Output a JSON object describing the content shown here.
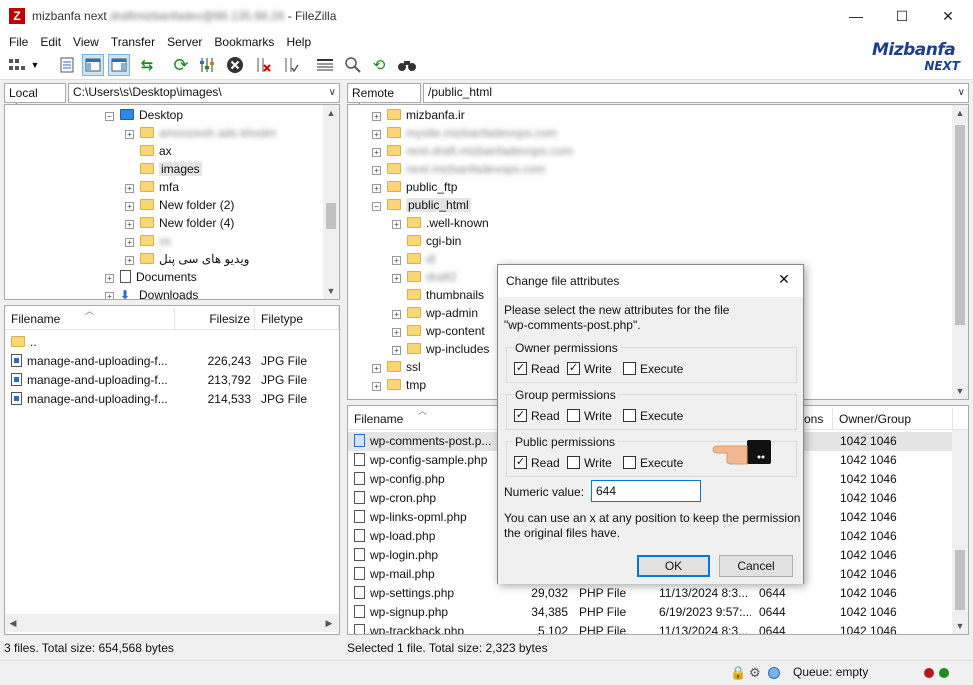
{
  "window": {
    "title_site": "mizbanfa next",
    "title_blurred": "draftmizbanfadev@86.135.68.26",
    "title_app": "- FileZilla",
    "controls": {
      "minimize": "—",
      "maximize": "☐",
      "close": "✕"
    }
  },
  "menu": [
    "File",
    "Edit",
    "View",
    "Transfer",
    "Server",
    "Bookmarks",
    "Help"
  ],
  "brand": {
    "name": "Mizbanfa",
    "sub": "NEXT"
  },
  "local": {
    "label": "Local site:",
    "path": "C:\\Users\\s\\Desktop\\images\\",
    "tree": [
      {
        "label": "Desktop",
        "expander": "-",
        "blurred": false,
        "kind": "desktop"
      },
      {
        "label": "amoozesh ads khodm",
        "expander": "+",
        "blurred": true
      },
      {
        "label": "ax",
        "expander": "",
        "blurred": false
      },
      {
        "label": "images",
        "expander": "",
        "blurred": false,
        "selected": true
      },
      {
        "label": "mfa",
        "expander": "+",
        "blurred": false
      },
      {
        "label": "New folder (2)",
        "expander": "+",
        "blurred": false
      },
      {
        "label": "New folder (4)",
        "expander": "+",
        "blurred": false
      },
      {
        "label": "ss",
        "expander": "+",
        "blurred": true
      },
      {
        "label": "ویدیو های سی پنل",
        "expander": "+",
        "blurred": false
      },
      {
        "label": "Documents",
        "expander": "+",
        "blurred": false,
        "kind": "docs"
      },
      {
        "label": "Downloads",
        "expander": "+",
        "blurred": false,
        "kind": "downloads"
      }
    ],
    "columns": [
      "Filename",
      "Filesize",
      "Filetype"
    ],
    "files": [
      {
        "name": "..",
        "size": "",
        "type": "",
        "kind": "folder"
      },
      {
        "name": "manage-and-uploading-f...",
        "size": "226,243",
        "type": "JPG File",
        "kind": "jpg"
      },
      {
        "name": "manage-and-uploading-f...",
        "size": "213,792",
        "type": "JPG File",
        "kind": "jpg"
      },
      {
        "name": "manage-and-uploading-f...",
        "size": "214,533",
        "type": "JPG File",
        "kind": "jpg"
      }
    ],
    "status": "3 files. Total size: 654,568 bytes"
  },
  "remote": {
    "label": "Remote site:",
    "path": "/public_html",
    "tree": [
      {
        "label": "mizbanfa.ir",
        "indent": 0,
        "expander": "+",
        "blurred": false
      },
      {
        "label": "mysite.mizbanfadevops.com",
        "indent": 0,
        "expander": "+",
        "blurred": true
      },
      {
        "label": "next.draft.mizbanfadevops.com",
        "indent": 0,
        "expander": "+",
        "blurred": true
      },
      {
        "label": "next.mizbanfadevops.com",
        "indent": 0,
        "expander": "+",
        "blurred": true
      },
      {
        "label": "public_ftp",
        "indent": 0,
        "expander": "+",
        "blurred": false
      },
      {
        "label": "public_html",
        "indent": 0,
        "expander": "-",
        "blurred": false,
        "selected": true
      },
      {
        "label": ".well-known",
        "indent": 1,
        "expander": "+",
        "blurred": false
      },
      {
        "label": "cgi-bin",
        "indent": 1,
        "expander": "",
        "blurred": false
      },
      {
        "label": "dl",
        "indent": 1,
        "expander": "+",
        "blurred": true
      },
      {
        "label": "draft2",
        "indent": 1,
        "expander": "+",
        "blurred": true
      },
      {
        "label": "thumbnails",
        "indent": 1,
        "expander": "",
        "blurred": false
      },
      {
        "label": "wp-admin",
        "indent": 1,
        "expander": "+",
        "blurred": false
      },
      {
        "label": "wp-content",
        "indent": 1,
        "expander": "+",
        "blurred": false
      },
      {
        "label": "wp-includes",
        "indent": 1,
        "expander": "+",
        "blurred": false
      },
      {
        "label": "ssl",
        "indent": 0,
        "expander": "+",
        "blurred": false
      },
      {
        "label": "tmp",
        "indent": 0,
        "expander": "+",
        "blurred": false
      }
    ],
    "columns": [
      "Filename",
      "ons",
      "Owner/Group"
    ],
    "files": [
      {
        "name": "wp-comments-post.p...",
        "size": "",
        "type": "",
        "modified": "",
        "perm": "",
        "owner": "1042 1046",
        "selected": true
      },
      {
        "name": "wp-config-sample.php",
        "size": "",
        "type": "",
        "modified": "",
        "perm": "",
        "owner": "1042 1046"
      },
      {
        "name": "wp-config.php",
        "size": "",
        "type": "",
        "modified": "",
        "perm": "",
        "owner": "1042 1046"
      },
      {
        "name": "wp-cron.php",
        "size": "",
        "type": "",
        "modified": "",
        "perm": "",
        "owner": "1042 1046"
      },
      {
        "name": "wp-links-opml.php",
        "size": "",
        "type": "",
        "modified": "",
        "perm": "",
        "owner": "1042 1046"
      },
      {
        "name": "wp-load.php",
        "size": "",
        "type": "",
        "modified": "",
        "perm": "",
        "owner": "1042 1046"
      },
      {
        "name": "wp-login.php",
        "size": "",
        "type": "",
        "modified": "",
        "perm": "",
        "owner": "1042 1046"
      },
      {
        "name": "wp-mail.php",
        "size": "",
        "type": "",
        "modified": "",
        "perm": "",
        "owner": "1042 1046"
      },
      {
        "name": "wp-settings.php",
        "size": "29,032",
        "type": "PHP File",
        "modified": "11/13/2024 8:3...",
        "perm": "0644",
        "owner": "1042 1046"
      },
      {
        "name": "wp-signup.php",
        "size": "34,385",
        "type": "PHP File",
        "modified": "6/19/2023 9:57:...",
        "perm": "0644",
        "owner": "1042 1046"
      },
      {
        "name": "wp-trackback.php",
        "size": "5,102",
        "type": "PHP File",
        "modified": "11/13/2024 8:3...",
        "perm": "0644",
        "owner": "1042 1046"
      }
    ],
    "status": "Selected 1 file. Total size: 2,323 bytes"
  },
  "queue": {
    "label": "Queue: empty"
  },
  "dialog": {
    "title": "Change file attributes",
    "close": "✕",
    "desc1": "Please select the new attributes for the file",
    "desc2": "\"wp-comments-post.php\".",
    "groups": [
      {
        "title": "Owner permissions",
        "read": true,
        "write": true,
        "execute": false
      },
      {
        "title": "Group permissions",
        "read": true,
        "write": false,
        "execute": false
      },
      {
        "title": "Public permissions",
        "read": true,
        "write": false,
        "execute": false
      }
    ],
    "perm_labels": {
      "read": "Read",
      "write": "Write",
      "execute": "Execute"
    },
    "numeric_label": "Numeric value:",
    "numeric_value": "644",
    "hint1": "You can use an x at any position to keep the permission",
    "hint2": "the original files have.",
    "ok": "OK",
    "cancel": "Cancel"
  }
}
